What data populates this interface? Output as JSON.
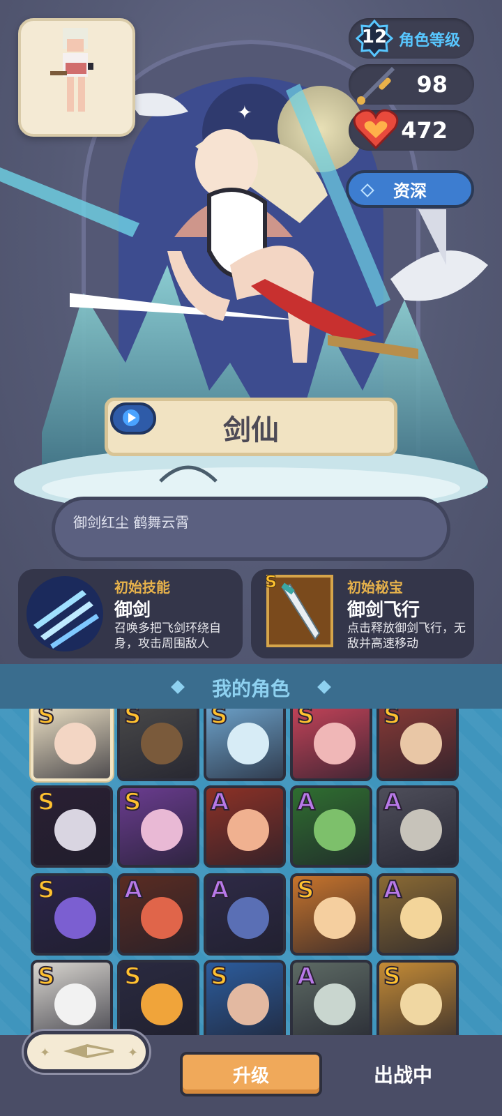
{
  "character": {
    "level": "12",
    "level_label": "角色等级",
    "attack": "98",
    "hp": "472",
    "rank": "资深",
    "name": "剑仙",
    "quote": "御剑红尘 鹤舞云霄"
  },
  "skill": {
    "caption": "初始技能",
    "title": "御剑",
    "desc": "召唤多把飞剑环绕自身，攻击周围敌人"
  },
  "treasure": {
    "grade": "S",
    "caption": "初始秘宝",
    "title": "御剑飞行",
    "desc": "点击释放御剑飞行，无敌并高速移动"
  },
  "my_characters": {
    "title": "我的角色",
    "tiles": [
      {
        "grade": "S",
        "color": "#f2e6c9",
        "skin": "#f3d6c4"
      },
      {
        "grade": "S",
        "color": "#4a4a4a",
        "skin": "#7a5a3b"
      },
      {
        "grade": "S",
        "color": "#6fa6cf",
        "skin": "#d7ecf6"
      },
      {
        "grade": "S",
        "color": "#c9445a",
        "skin": "#f0b7b7"
      },
      {
        "grade": "S",
        "color": "#8a3a36",
        "skin": "#e9c7a6"
      },
      {
        "grade": "S",
        "color": "#2a1f33",
        "skin": "#d9d5e1"
      },
      {
        "grade": "S",
        "color": "#6a3c8f",
        "skin": "#e9b9d5"
      },
      {
        "grade": "A",
        "color": "#8c3126",
        "skin": "#f0b190"
      },
      {
        "grade": "A",
        "color": "#2f6e30",
        "skin": "#7dc06b"
      },
      {
        "grade": "A",
        "color": "#4e4e5a",
        "skin": "#c7c3ba"
      },
      {
        "grade": "S",
        "color": "#2b2448",
        "skin": "#7b5fd1"
      },
      {
        "grade": "A",
        "color": "#5a2c22",
        "skin": "#e0654a"
      },
      {
        "grade": "A",
        "color": "#2e2a46",
        "skin": "#5a6fb5"
      },
      {
        "grade": "S",
        "color": "#c7742c",
        "skin": "#f5cf9f"
      },
      {
        "grade": "A",
        "color": "#8a6a34",
        "skin": "#f3d59a"
      },
      {
        "grade": "S",
        "color": "#d9d6d0",
        "skin": "#f2f2f2"
      },
      {
        "grade": "S",
        "color": "#2a2a40",
        "skin": "#f0a43a"
      },
      {
        "grade": "S",
        "color": "#2c5c9c",
        "skin": "#e3b9a1"
      },
      {
        "grade": "A",
        "color": "#5d6a64",
        "skin": "#c9d6cf"
      },
      {
        "grade": "S",
        "color": "#c48b36",
        "skin": "#f0d7a2"
      }
    ]
  },
  "buttons": {
    "upgrade": "升级",
    "status": "出战中"
  },
  "colors": {
    "accent_blue": "#58c7ff",
    "grade_s": "#ffc12f",
    "grade_a": "#b879e8",
    "upgrade_orange": "#f0a95a"
  }
}
